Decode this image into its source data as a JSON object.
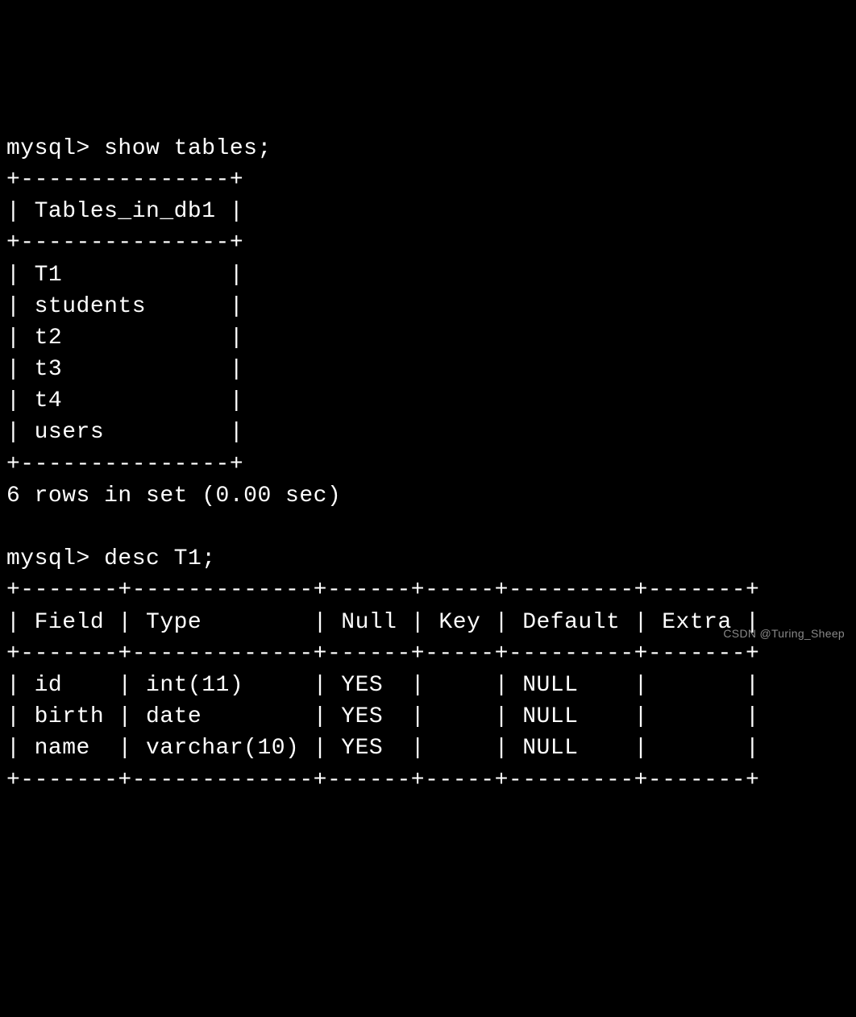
{
  "prompt": "mysql> ",
  "cmd1": "show tables;",
  "table1_border_top": "+---------------+",
  "table1_header": "| Tables_in_db1 |",
  "table1_row1": "| T1            |",
  "table1_row2": "| students      |",
  "table1_row3": "| t2            |",
  "table1_row4": "| t3            |",
  "table1_row5": "| t4            |",
  "table1_row6": "| users         |",
  "table1_footer": "6 rows in set (0.00 sec)",
  "blank": "",
  "cmd2": "desc T1;",
  "table2_border": "+-------+-------------+------+-----+---------+-------+",
  "table2_header": "| Field | Type        | Null | Key | Default | Extra |",
  "table2_row1": "| id    | int(11)     | YES  |     | NULL    |       |",
  "table2_row2": "| birth | date        | YES  |     | NULL    |       |",
  "table2_row3": "| name  | varchar(10) | YES  |     | NULL    |       |",
  "watermark": "CSDN @Turing_Sheep"
}
